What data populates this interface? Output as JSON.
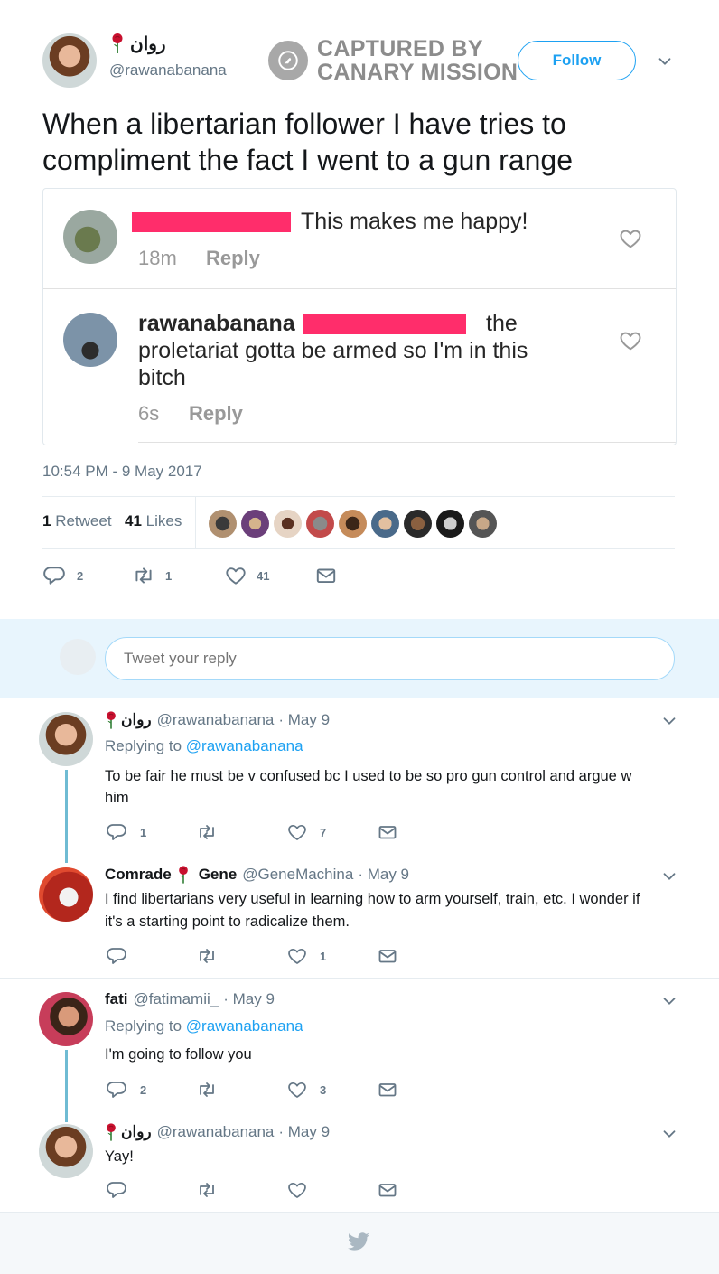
{
  "tweet": {
    "display_name": "روان",
    "handle": "@rawanabanana",
    "follow_label": "Follow",
    "watermark_line1": "CAPTURED BY",
    "watermark_line2": "CANARY MISSION",
    "text": "When a libertarian follower I have tries to compliment the fact I went to a gun range",
    "timestamp": "10:54 PM - 9 May 2017",
    "retweets_count": "1",
    "retweets_label": "Retweet",
    "likes_count": "41",
    "likes_label": "Likes",
    "action_replies": "2",
    "action_retweets": "1",
    "action_likes": "41"
  },
  "embedded": {
    "comment1": {
      "text": "This makes me happy!",
      "time": "18m",
      "reply": "Reply"
    },
    "comment2": {
      "username": "rawanabanana",
      "text_tail": "the",
      "text_line2": "proletariat gotta be armed so I'm in this",
      "text_line3": "bitch",
      "time": "6s",
      "reply": "Reply"
    }
  },
  "reply_box": {
    "placeholder": "Tweet your reply"
  },
  "replies": [
    {
      "name": "روان",
      "handle": "@rawanabanana",
      "date": "· May 9",
      "replying_to_label": "Replying to",
      "replying_to_handle": "@rawanabanana",
      "text_line1": "To be fair he must be v confused bc I used to be so pro gun control and argue w",
      "text_line2": "him",
      "replies": "1",
      "retweets": "",
      "likes": "7"
    },
    {
      "name_part1": "Comrade",
      "name_part2": "Gene",
      "handle": "@GeneMachina",
      "date": "· May 9",
      "text_line1": "I find libertarians very useful in learning how to arm yourself, train, etc. I wonder if",
      "text_line2": "it's a starting point to radicalize them.",
      "replies": "",
      "retweets": "",
      "likes": "1"
    },
    {
      "name": "fati",
      "handle": "@fatimamii_",
      "date": "· May 9",
      "replying_to_label": "Replying to",
      "replying_to_handle": "@rawanabanana",
      "text_line1": "I'm going to follow you",
      "replies": "2",
      "retweets": "",
      "likes": "3"
    },
    {
      "name": "روان",
      "handle": "@rawanabanana",
      "date": "· May 9",
      "text_line1": "Yay!",
      "replies": "",
      "retweets": "",
      "likes": ""
    }
  ],
  "colors": {
    "accent": "#1da1f2",
    "muted": "#657786",
    "redaction": "#ff2d6b",
    "rose": "#c8102e"
  }
}
